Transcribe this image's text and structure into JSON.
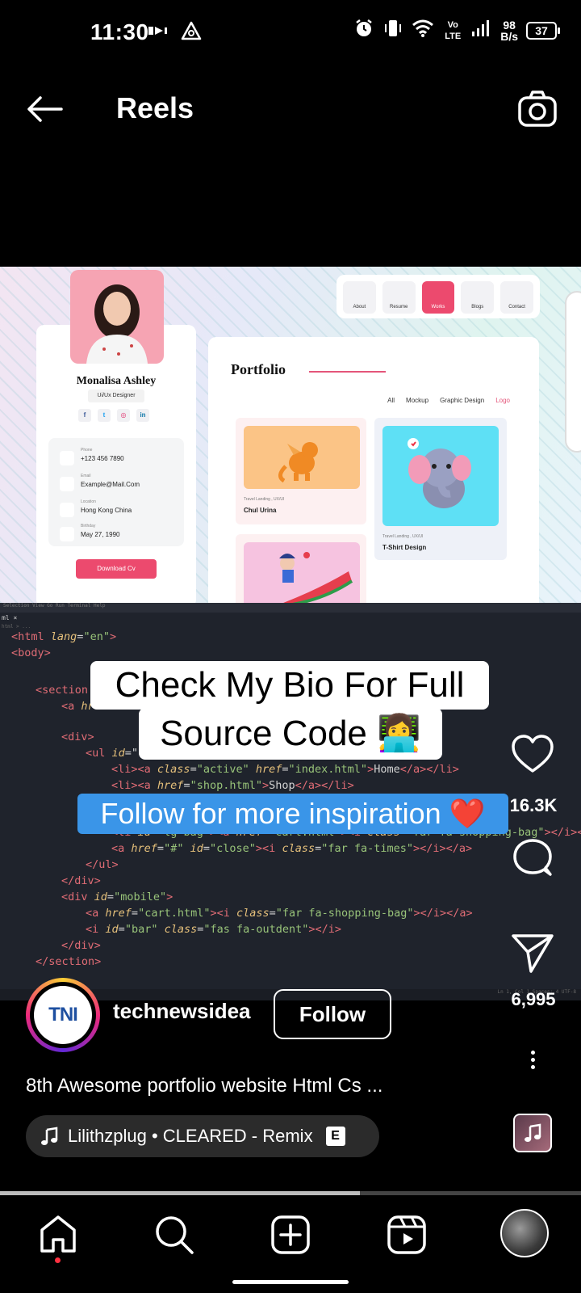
{
  "status_bar": {
    "time": "11:30",
    "net_speed_value": "98",
    "net_speed_unit": "B/s",
    "volte": "Vo LTE",
    "battery": "37"
  },
  "header": {
    "title": "Reels"
  },
  "website": {
    "nav": [
      "About",
      "Resume",
      "Works",
      "Blogs",
      "Contact"
    ],
    "active_nav": "Works",
    "name": "Monalisa Ashley",
    "role": "Ui/Ux Designer",
    "socials": [
      "f",
      "t",
      "◎",
      "in"
    ],
    "contacts": [
      {
        "label": "Phone",
        "value": "+123 456 7890"
      },
      {
        "label": "Email",
        "value": "Example@Mail.Com"
      },
      {
        "label": "Location",
        "value": "Hong Kong China"
      },
      {
        "label": "Birthday",
        "value": "May 27, 1990"
      }
    ],
    "download": "Download Cv",
    "portfolio_title": "Portfolio",
    "filters": [
      "All",
      "Mockup",
      "Graphic Design",
      "Logo"
    ],
    "cards": [
      {
        "caption": "Travel Landing , UX/UI",
        "title": "Chul Urina"
      },
      {
        "caption": "Travel Landing , UX/UI",
        "title": "T-Shirt Design"
      }
    ]
  },
  "code_editor": {
    "menu": "Selection  View  Go  Run  Terminal  Help",
    "tab": "ml ×",
    "crumb": "html > ...",
    "status": "Ln 1, Col 1   Spaces: 4   UTF-8"
  },
  "overlay": {
    "line1": "Check My Bio For Full",
    "line2": "Source Code 👩‍💻",
    "line3": "Follow for more inspiration ❤️"
  },
  "actions": {
    "likes": "16.3K",
    "shares": "6,995"
  },
  "author": {
    "logo": "TNI",
    "name": "technewsidea",
    "follow_label": "Follow"
  },
  "post": {
    "caption": "8th Awesome portfolio website Html Cs ...",
    "music": "Lilithzplug • CLEARED - Remix",
    "explicit": "E"
  },
  "progress": 0.62,
  "colors": {
    "accent_pink": "#ec4a6e",
    "caption_blue": "#3a95e8",
    "notification_dot": "#ff3040"
  },
  "icons": [
    "back-arrow-icon",
    "camera-icon",
    "heart-icon",
    "comment-icon",
    "share-icon",
    "more-icon",
    "music-note-icon",
    "home-icon",
    "search-icon",
    "create-icon",
    "reels-icon"
  ]
}
